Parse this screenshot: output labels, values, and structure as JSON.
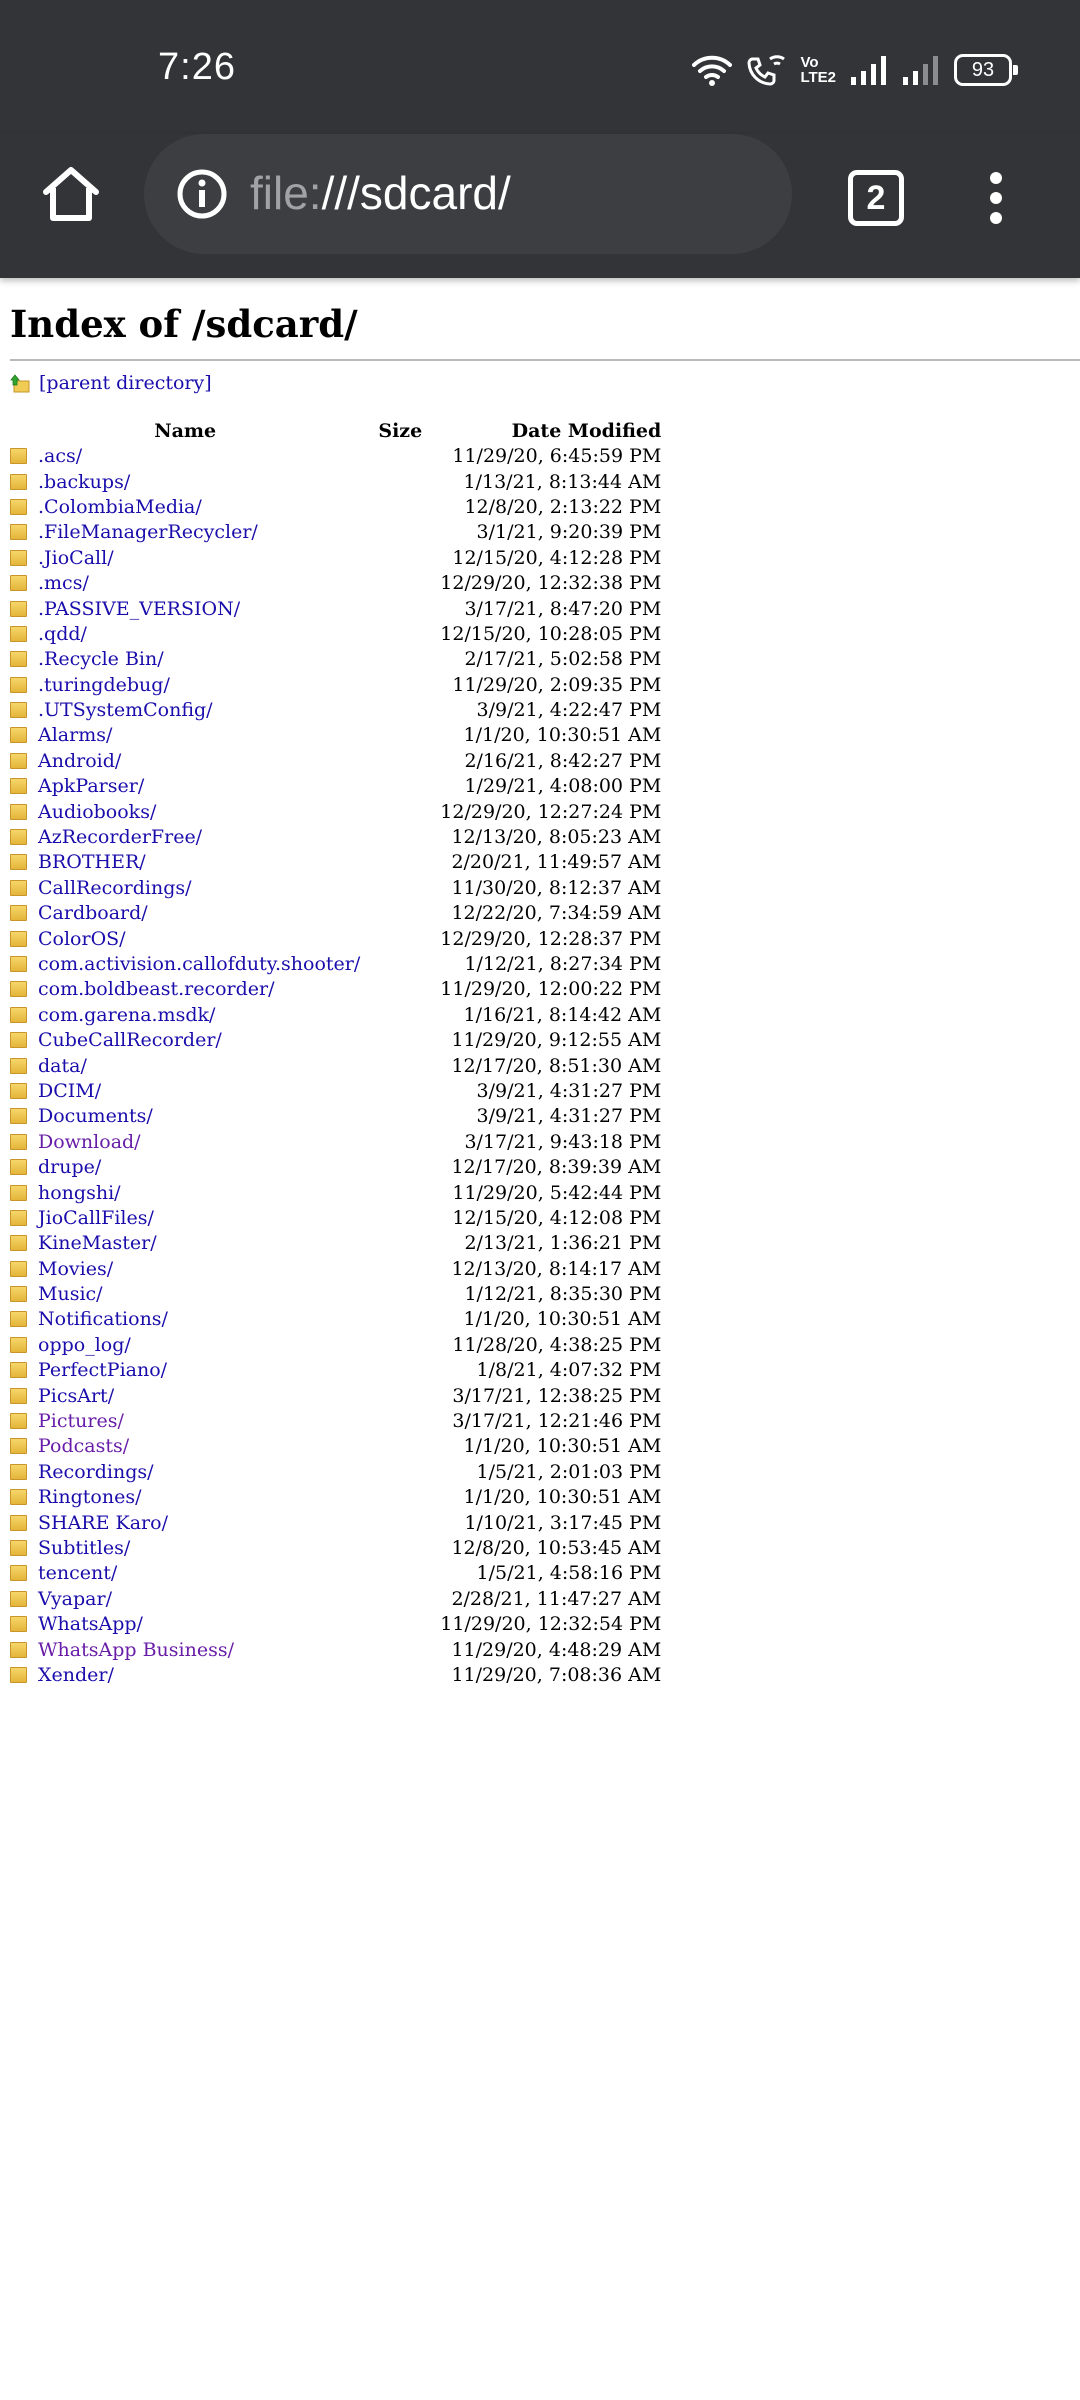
{
  "status_bar": {
    "time": "7:26",
    "network_label_top": "Vo",
    "network_label_bottom": "LTE2",
    "battery": "93",
    "icons": [
      "wifi-icon",
      "wifi-call-icon",
      "volte-icon",
      "signal-sim1-icon",
      "signal-sim2-icon",
      "battery-icon"
    ]
  },
  "toolbar": {
    "url_scheme": "file:",
    "url_path": "///sdcard/",
    "tab_count": "2"
  },
  "page": {
    "title": "Index of /sdcard/",
    "parent_link": "[parent directory]",
    "columns": {
      "name": "Name",
      "size": "Size",
      "date": "Date Modified"
    },
    "entries": [
      {
        "name": ".acs/",
        "date": "11/29/20, 6:45:59 PM"
      },
      {
        "name": ".backups/",
        "date": "1/13/21, 8:13:44 AM"
      },
      {
        "name": ".ColombiaMedia/",
        "date": "12/8/20, 2:13:22 PM"
      },
      {
        "name": ".FileManagerRecycler/",
        "date": "3/1/21, 9:20:39 PM"
      },
      {
        "name": ".JioCall/",
        "date": "12/15/20, 4:12:28 PM"
      },
      {
        "name": ".mcs/",
        "date": "12/29/20, 12:32:38 PM"
      },
      {
        "name": ".PASSIVE_VERSION/",
        "date": "3/17/21, 8:47:20 PM"
      },
      {
        "name": ".qdd/",
        "date": "12/15/20, 10:28:05 PM"
      },
      {
        "name": ".Recycle Bin/",
        "date": "2/17/21, 5:02:58 PM"
      },
      {
        "name": ".turingdebug/",
        "date": "11/29/20, 2:09:35 PM"
      },
      {
        "name": ".UTSystemConfig/",
        "date": "3/9/21, 4:22:47 PM"
      },
      {
        "name": "Alarms/",
        "date": "1/1/20, 10:30:51 AM"
      },
      {
        "name": "Android/",
        "date": "2/16/21, 8:42:27 PM"
      },
      {
        "name": "ApkParser/",
        "date": "1/29/21, 4:08:00 PM"
      },
      {
        "name": "Audiobooks/",
        "date": "12/29/20, 12:27:24 PM"
      },
      {
        "name": "AzRecorderFree/",
        "date": "12/13/20, 8:05:23 AM"
      },
      {
        "name": "BROTHER/",
        "date": "2/20/21, 11:49:57 AM"
      },
      {
        "name": "CallRecordings/",
        "date": "11/30/20, 8:12:37 AM"
      },
      {
        "name": "Cardboard/",
        "date": "12/22/20, 7:34:59 AM"
      },
      {
        "name": "ColorOS/",
        "date": "12/29/20, 12:28:37 PM"
      },
      {
        "name": "com.activision.callofduty.shooter/",
        "date": "1/12/21, 8:27:34 PM"
      },
      {
        "name": "com.boldbeast.recorder/",
        "date": "11/29/20, 12:00:22 PM"
      },
      {
        "name": "com.garena.msdk/",
        "date": "1/16/21, 8:14:42 AM"
      },
      {
        "name": "CubeCallRecorder/",
        "date": "11/29/20, 9:12:55 AM"
      },
      {
        "name": "data/",
        "date": "12/17/20, 8:51:30 AM"
      },
      {
        "name": "DCIM/",
        "date": "3/9/21, 4:31:27 PM"
      },
      {
        "name": "Documents/",
        "date": "3/9/21, 4:31:27 PM"
      },
      {
        "name": "Download/",
        "date": "3/17/21, 9:43:18 PM",
        "visited": true
      },
      {
        "name": "drupe/",
        "date": "12/17/20, 8:39:39 AM"
      },
      {
        "name": "hongshi/",
        "date": "11/29/20, 5:42:44 PM"
      },
      {
        "name": "JioCallFiles/",
        "date": "12/15/20, 4:12:08 PM"
      },
      {
        "name": "KineMaster/",
        "date": "2/13/21, 1:36:21 PM"
      },
      {
        "name": "Movies/",
        "date": "12/13/20, 8:14:17 AM"
      },
      {
        "name": "Music/",
        "date": "1/12/21, 8:35:30 PM"
      },
      {
        "name": "Notifications/",
        "date": "1/1/20, 10:30:51 AM"
      },
      {
        "name": "oppo_log/",
        "date": "11/28/20, 4:38:25 PM"
      },
      {
        "name": "PerfectPiano/",
        "date": "1/8/21, 4:07:32 PM"
      },
      {
        "name": "PicsArt/",
        "date": "3/17/21, 12:38:25 PM"
      },
      {
        "name": "Pictures/",
        "date": "3/17/21, 12:21:46 PM",
        "visited": true
      },
      {
        "name": "Podcasts/",
        "date": "1/1/20, 10:30:51 AM",
        "visited": true
      },
      {
        "name": "Recordings/",
        "date": "1/5/21, 2:01:03 PM"
      },
      {
        "name": "Ringtones/",
        "date": "1/1/20, 10:30:51 AM"
      },
      {
        "name": "SHARE Karo/",
        "date": "1/10/21, 3:17:45 PM"
      },
      {
        "name": "Subtitles/",
        "date": "12/8/20, 10:53:45 AM"
      },
      {
        "name": "tencent/",
        "date": "1/5/21, 4:58:16 PM"
      },
      {
        "name": "Vyapar/",
        "date": "2/28/21, 11:47:27 AM"
      },
      {
        "name": "WhatsApp/",
        "date": "11/29/20, 12:32:54 PM"
      },
      {
        "name": "WhatsApp Business/",
        "date": "11/29/20, 4:48:29 AM",
        "visited": true
      },
      {
        "name": "Xender/",
        "date": "11/29/20, 7:08:36 AM"
      }
    ]
  },
  "colors": {
    "chrome_bar": "#323437",
    "url_field": "#3c3e42",
    "link": "#1a0dab",
    "visited_link": "#681da8"
  }
}
